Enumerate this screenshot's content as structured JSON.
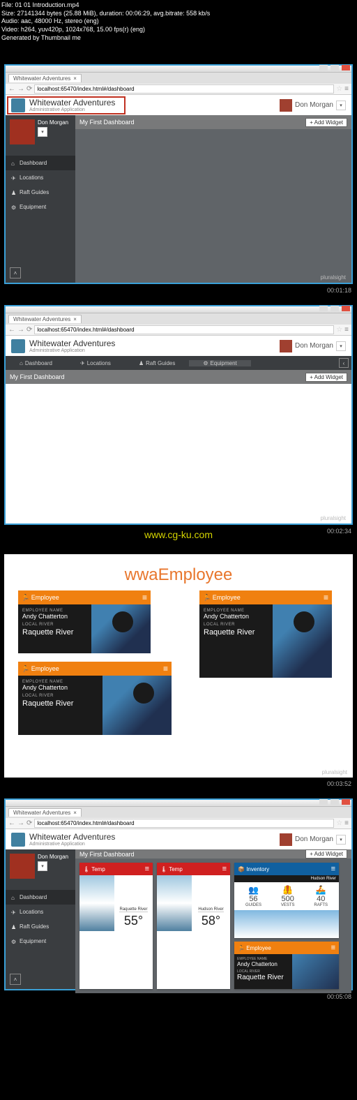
{
  "meta": {
    "l1": "File: 01 01 Introduction.mp4",
    "l2": "Size: 27141344 bytes (25.88 MiB), duration: 00:06:29, avg.bitrate: 558 kb/s",
    "l3": "Audio: aac, 48000 Hz, stereo (eng)",
    "l4": "Video: h264, yuv420p, 1024x768, 15.00 fps(r) (eng)",
    "l5": "Generated by Thumbnail me"
  },
  "timestamps": {
    "t1": "00:01:18",
    "t2": "00:02:34",
    "t3": "00:03:52",
    "t4": "00:05:08"
  },
  "site_url": "www.cg-ku.com",
  "watermark": "pluralsight",
  "browser": {
    "tab": "Whitewater Adventures",
    "url": "localhost:65470/index.html#/dashboard"
  },
  "brand": {
    "title": "Whitewater Adventures",
    "subtitle": "Administrative Application",
    "user": "Don Morgan"
  },
  "dashboard": {
    "title": "My First Dashboard",
    "add_widget": "+ Add Widget"
  },
  "sidebar": {
    "user": "Don Morgan",
    "items": [
      {
        "icon": "⌂",
        "label": "Dashboard"
      },
      {
        "icon": "✈",
        "label": "Locations"
      },
      {
        "icon": "♟",
        "label": "Raft Guides"
      },
      {
        "icon": "⚙",
        "label": "Equipment"
      }
    ]
  },
  "hnav": [
    {
      "icon": "⌂",
      "label": "Dashboard"
    },
    {
      "icon": "✈",
      "label": "Locations"
    },
    {
      "icon": "♟",
      "label": "Raft Guides"
    },
    {
      "icon": "⚙",
      "label": "Equipment"
    }
  ],
  "slide3": {
    "title": "wwaEmployee",
    "card": {
      "badge": "Employee",
      "name_label": "EMPLOYEE NAME",
      "name": "Andy Chatterton",
      "river_label": "LOCAL RIVER",
      "river": "Raquette River"
    }
  },
  "widgets": {
    "temp1": {
      "title": "Temp",
      "loc": "Raquette River",
      "val": "55°"
    },
    "temp2": {
      "title": "Temp",
      "loc": "Hudson River",
      "val": "58°"
    },
    "inventory": {
      "title": "Inventory",
      "sub": "Hudson River",
      "guides_n": "56",
      "guides_l": "GUIDES",
      "vests_n": "500",
      "vests_l": "VESTS",
      "rafts_n": "40",
      "rafts_l": "RAFTS"
    },
    "employee": {
      "title": "Employee",
      "name_label": "EMPLOYEE NAME",
      "name": "Andy Chatterton",
      "river_label": "LOCAL RIVER",
      "river": "Raquette River"
    }
  }
}
